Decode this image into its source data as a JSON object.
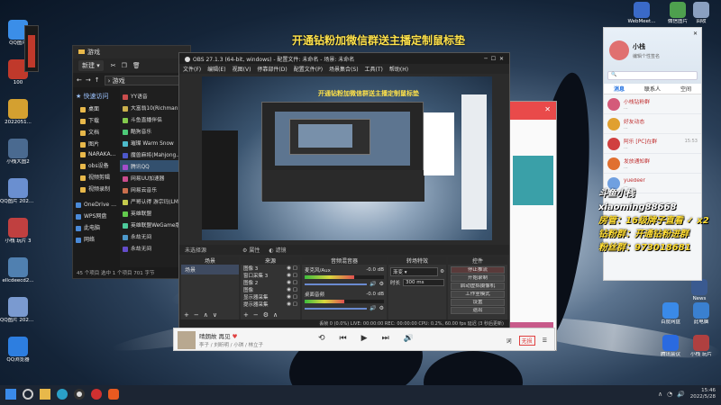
{
  "banner": "开通钻粉加微信群送主播定制鼠标垫",
  "colors": {
    "obs_bg": "#2b2b2b",
    "obs_panel": "#333333",
    "accent": "#3f6fd0",
    "meter_green": "#3dbb3d",
    "danger": "#e05050",
    "chat_bg": "#f4f6f8",
    "taskbar": "#1c2533"
  },
  "desktop_left_icons": [
    {
      "label": "QQ图片",
      "color": "#3b8ee8",
      "icon": "image-icon"
    },
    {
      "label": "100",
      "color": "#c0392b",
      "icon": "volume-meter-icon"
    },
    {
      "label": "2022051...",
      "color": "#d4a030",
      "icon": "image-icon"
    },
    {
      "label": "小栈大图2",
      "color": "#4a6a90",
      "icon": "image-icon"
    },
    {
      "label": "QQ图片 20220519...",
      "color": "#6a8fd0",
      "icon": "image-icon"
    },
    {
      "label": "小栈 玩片 3",
      "color": "#c04040",
      "icon": "image-icon"
    },
    {
      "label": "ellcdeecd2...",
      "color": "#5080b0",
      "icon": "image-icon"
    },
    {
      "label": "QQ图片 20220525...",
      "color": "#7a9ad0",
      "icon": "image-icon"
    },
    {
      "label": "QQ浏览器",
      "color": "#2d7ee0",
      "icon": "browser-icon"
    }
  ],
  "desktop_right_icons": [
    {
      "label": "WebMeet...",
      "color": "#3a6ac8",
      "icon": "meeting-icon"
    },
    {
      "label": "微信图片",
      "color": "#4ea04e",
      "icon": "image-icon"
    },
    {
      "label": "回收",
      "color": "#8aa0c0",
      "icon": "recycle-bin-icon"
    },
    {
      "label": "News",
      "color": "#3a5a90",
      "icon": "news-icon"
    },
    {
      "label": "百度网盘",
      "color": "#3a8ae8",
      "icon": "cloud-icon"
    },
    {
      "label": "此电脑",
      "color": "#3a80d0",
      "icon": "computer-icon"
    },
    {
      "label": "腾讯会议",
      "color": "#2a6ae0",
      "icon": "meeting-icon"
    },
    {
      "label": "小栈 玩片",
      "color": "#b04040",
      "icon": "image-icon"
    }
  ],
  "explorer": {
    "title": "游戏",
    "new_label": "新建",
    "path": "游戏",
    "quick_access": "快速访问",
    "sidebar": [
      "桌面",
      "下载",
      "文档",
      "图片",
      "NARAKA BLA...",
      "obs设备",
      "视频剪辑",
      "视频录制"
    ],
    "sidebar2": [
      "OneDrive - Pers...",
      "WPS网盘",
      "此电脑",
      "网络"
    ],
    "files": [
      "YY语音",
      "大富翁10(Richman...",
      "斗鱼直播伴侣",
      "酷狗音乐",
      "璀璨 Warm Snow",
      "魔兽麻将(Mahjong...",
      "腾讯QQ",
      "网易UU加速器",
      "网易云音乐",
      "严哥认得 游宗玛(LM...",
      "英雄联盟",
      "英雄联盟WeGame版",
      "永劫无间",
      "永劫无间"
    ],
    "status": "45 个项目   选中 1 个项目 701 字节"
  },
  "obs": {
    "title": "OBS 27.1.3 (64-bit, windows) - 配置文件: 未命名 - 场景: 未命名",
    "menu": [
      "文件(F)",
      "编辑(E)",
      "视图(V)",
      "停靠部件(D)",
      "配置文件(P)",
      "场景集合(S)",
      "工具(T)",
      "帮助(H)"
    ],
    "toolbar_source_label": "未选择源",
    "props_label": "属性",
    "filters_label": "滤镜",
    "panel_scenes": "场景",
    "panel_sources": "来源",
    "panel_mixer": "音频混音器",
    "panel_transitions": "转场特效",
    "panel_controls": "控件",
    "scenes": [
      "场景"
    ],
    "sources": [
      "图像 3",
      "窗口采集 3",
      "图像 2",
      "图像",
      "显示器采集",
      "提示器采集"
    ],
    "mixer": [
      {
        "name": "麦克风/Aux",
        "db": "-0.0 dB",
        "level": 0.62
      },
      {
        "name": "桌面音频",
        "db": "-0.0 dB",
        "level": 0.5
      }
    ],
    "transition_name": "渐变",
    "duration_label": "时长",
    "duration_value": "300 ms",
    "controls": [
      "停止推流",
      "开始录制",
      "启动虚拟摄像机",
      "工作室模式",
      "设置",
      "退出"
    ],
    "status": "丢帧 0 (0.0%)   LIVE: 00:00:00   REC: 00:00:00   CPU: 0.2%, 60.00 fps   延迟 (3 秒后更新)"
  },
  "preview_banner": "开通钻粉加微信群送主播定制鼠标垫",
  "music": {
    "title": "晴朗故 再见",
    "artist": "李子 / 刘昕明 / 小琪 / 林立子",
    "lyric_label": "词",
    "word_badge": "无损"
  },
  "chat": {
    "name": "小栈",
    "status": "编辑个性签名",
    "tabs": [
      "消息",
      "联系人",
      "空间"
    ],
    "items": [
      {
        "name": "小栈钻粉群",
        "time": "",
        "msg": "...",
        "color": "#d45a7a"
      },
      {
        "name": "好友动态",
        "time": "",
        "msg": "...",
        "color": "#e0a030"
      },
      {
        "name": "阿乐 [PC]在群",
        "time": "15:53",
        "msg": "...",
        "color": "#d04040"
      },
      {
        "name": "发放通知群",
        "time": "",
        "msg": "...",
        "color": "#e07030"
      },
      {
        "name": "yuedeer",
        "time": "",
        "msg": "...",
        "color": "#70a0e0"
      }
    ]
  },
  "overlay": [
    {
      "label": "斗鱼小栈",
      "color": "#ffffff"
    },
    {
      "label": "xiaoming88668",
      "color": "#ffffff"
    },
    {
      "label": "房管：16级牌子直看 ✓ x2",
      "color": "#ffdd33"
    },
    {
      "label": "钻粉群：开通钻粉进群",
      "color": "#ffdd33"
    },
    {
      "label": "粉丝群：973018681",
      "color": "#ffdd33"
    }
  ],
  "taskbar": {
    "time": "15:46",
    "date": "2022/5/28"
  }
}
